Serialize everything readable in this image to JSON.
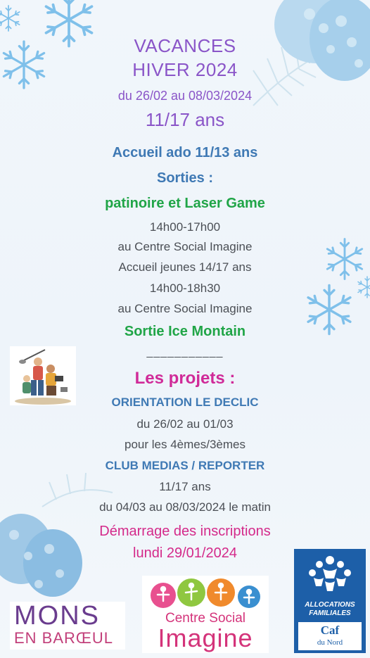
{
  "header": {
    "title_line1": "VACANCES",
    "title_line2": "HIVER 2024",
    "dates": "du 26/02 au 08/03/2024",
    "age": "11/17 ans"
  },
  "program": {
    "accueil_ado": "Accueil ado 11/13 ans",
    "sorties_label": "Sorties :",
    "sorties_detail": "patinoire et Laser Game",
    "time1": "14h00-17h00",
    "place1": "au Centre Social Imagine",
    "accueil_jeunes": "Accueil jeunes 14/17 ans",
    "time2": "14h00-18h30",
    "place2": "au Centre Social Imagine",
    "sortie_ice": "Sortie Ice Montain",
    "separator": "___________"
  },
  "projects": {
    "title": "Les projets :",
    "p1_name": "ORIENTATION LE DECLIC",
    "p1_dates": "du 26/02 au 01/03",
    "p1_audience": "pour les 4èmes/3èmes",
    "p2_name": "CLUB MEDIAS / REPORTER",
    "p2_age": "11/17 ans",
    "p2_dates": "du 04/03 au 08/03/2024 le matin"
  },
  "inscriptions": {
    "line1": "Démarrage des inscriptions",
    "line2": "lundi 29/01/2024"
  },
  "logos": {
    "mons_line1": "MONS",
    "mons_line2": "EN BARŒUL",
    "centre_line1": "Centre Social",
    "centre_line2": "Imagine",
    "caf_line1": "ALLOCATIONS",
    "caf_line2": "FAMILIALES",
    "caf_name": "Caf",
    "caf_region": "du Nord"
  },
  "colors": {
    "purple": "#8a55c8",
    "blue": "#3f79b4",
    "green": "#20a547",
    "magenta": "#d42a8a",
    "caf_blue": "#1d5fa8"
  }
}
